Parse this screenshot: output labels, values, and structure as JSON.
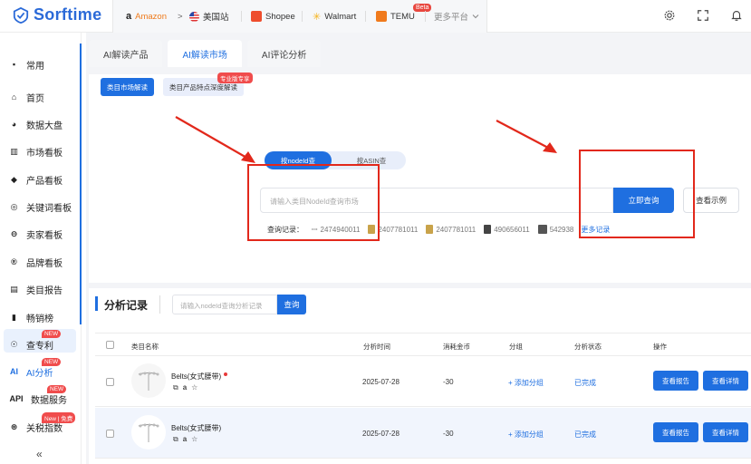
{
  "app": {
    "logo_text": "Sorftime"
  },
  "platforms": {
    "amazon": "Amazon",
    "arrow": ">",
    "site": "美国站",
    "shopee": "Shopee",
    "walmart": "Walmart",
    "temu": "TEMU",
    "temu_badge": "Beta",
    "more": "更多平台"
  },
  "sidebar": {
    "items": [
      {
        "label": "常用",
        "icon": "bookmark-icon"
      },
      {
        "label": "首页",
        "icon": "home-icon"
      },
      {
        "label": "数据大盘",
        "icon": "pie-chart-icon"
      },
      {
        "label": "市场看板",
        "icon": "map-icon"
      },
      {
        "label": "产品看板",
        "icon": "box-icon"
      },
      {
        "label": "关键词看板",
        "icon": "keyword-icon"
      },
      {
        "label": "卖家看板",
        "icon": "seller-icon"
      },
      {
        "label": "品牌看板",
        "icon": "brand-icon"
      },
      {
        "label": "类目报告",
        "icon": "report-icon"
      },
      {
        "label": "畅销榜",
        "icon": "bar-chart-icon"
      },
      {
        "label": "查专利",
        "icon": "patent-icon",
        "badge": "NEW"
      },
      {
        "label": "AI分析",
        "icon": "ai-icon",
        "icon_text": "AI",
        "badge": "NEW"
      },
      {
        "label": "数据服务",
        "icon": "api-icon",
        "icon_text": "API",
        "badge": "NEW"
      },
      {
        "label": "关税指数",
        "icon": "tariff-icon",
        "badge": "New | 免费"
      }
    ],
    "collapse": "«"
  },
  "tabs": [
    "AI解读产品",
    "AI解读市场",
    "AI评论分析"
  ],
  "subtabs": {
    "market": "类目市场解读",
    "feature": "类目产品特点深度解读",
    "feature_tag": "专业版专享"
  },
  "query": {
    "mode_a": "按nodeId查",
    "mode_b": "按ASIN查",
    "placeholder": "请输入类目NodeId查询市场",
    "submit": "立即查询",
    "example": "查看示例",
    "history_label": "查询记录：",
    "history": [
      "2474940011",
      "2407781011",
      "2407781011",
      "490656011",
      "542938"
    ],
    "more": "更多记录"
  },
  "records": {
    "title": "分析记录",
    "placeholder": "请输入nodeId查询分析记录",
    "search_btn": "查询",
    "columns": [
      "类目名称",
      "分析时间",
      "消耗金币",
      "分组",
      "分析状态",
      "操作"
    ],
    "rows": [
      {
        "name": "Belts(女式腰带)",
        "date": "2025-07-28",
        "coins": "-30",
        "group": "+ 添加分组",
        "status": "已完成",
        "report": "查看报告",
        "detail": "查看详情"
      },
      {
        "name": "Belts(女式腰带)",
        "date": "2025-07-28",
        "coins": "-30",
        "group": "+ 添加分组",
        "status": "已完成",
        "report": "查看报告",
        "detail": "查看详情"
      }
    ]
  },
  "colors": {
    "accent": "#1f6fe0",
    "annotation": "#e2281b",
    "badge": "#f04c4c"
  }
}
